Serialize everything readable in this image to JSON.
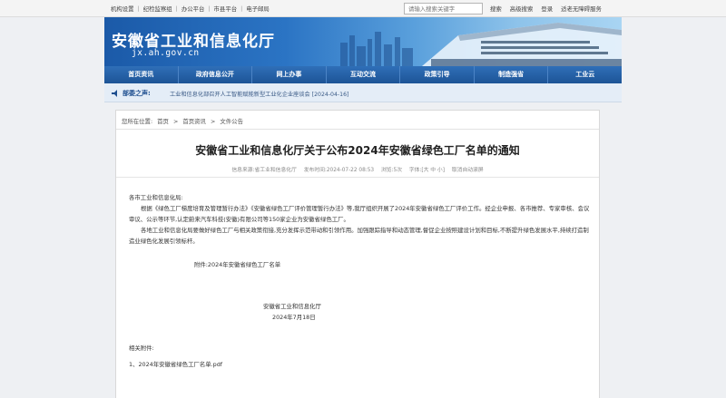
{
  "topbar": {
    "links": [
      "机构设置",
      "纪检监察组",
      "办公平台",
      "市县平台",
      "电子邮局"
    ],
    "search_placeholder": "请输入搜索关键字",
    "right_links": [
      "搜索",
      "高级搜索",
      "登录",
      "适老无障碍服务"
    ]
  },
  "banner": {
    "title": "安徽省工业和信息化厅",
    "domain": "jx.ah.gov.cn"
  },
  "nav": [
    "首页资讯",
    "政府信息公开",
    "网上办事",
    "互动交流",
    "政策引导",
    "制造强省",
    "工业云"
  ],
  "notice": {
    "label": "部委之声:",
    "text": "工业和信息化部召开人工智能赋能新型工业化企业座谈会 [2024-04-16]"
  },
  "breadcrumb": [
    "您所在位置:",
    "首页",
    ">",
    "首页资讯",
    ">",
    "文件公告"
  ],
  "article": {
    "title": "安徽省工业和信息化厅关于公布2024年安徽省绿色工厂名单的通知",
    "meta": [
      "信息来源:省工业和信息化厅",
      "发布时间:2024-07-22 08:53",
      "浏览:5次",
      "字体:[大 中 小]",
      "取消自动滚屏"
    ],
    "salutation": "各市工业和信息化局:",
    "para1": "根据《绿色工厂梯度培育及管理暂行办法》《安徽省绿色工厂评价管理暂行办法》等,我厅组织开展了2024年安徽省绿色工厂评价工作。经企业申报、各市推荐、专家审核、会议审议、公示等环节,认定蔚来汽车科技(安徽)有限公司等150家企业为安徽省绿色工厂。",
    "para2": "各地工业和信息化局要做好绿色工厂与相关政策衔接,充分发挥示范带动和引领作用。加强跟踪指导和动态管理,督促企业按照建设计划和目标,不断提升绿色发展水平,持续打造制造业绿色化发展引领标杆。",
    "attachment_line": "附件:2024年安徽省绿色工厂名单",
    "signature": "安徽省工业和信息化厅",
    "date": "2024年7月18日",
    "related_label": "相关附件:",
    "related_file": "1、2024年安徽省绿色工厂名单.pdf"
  }
}
